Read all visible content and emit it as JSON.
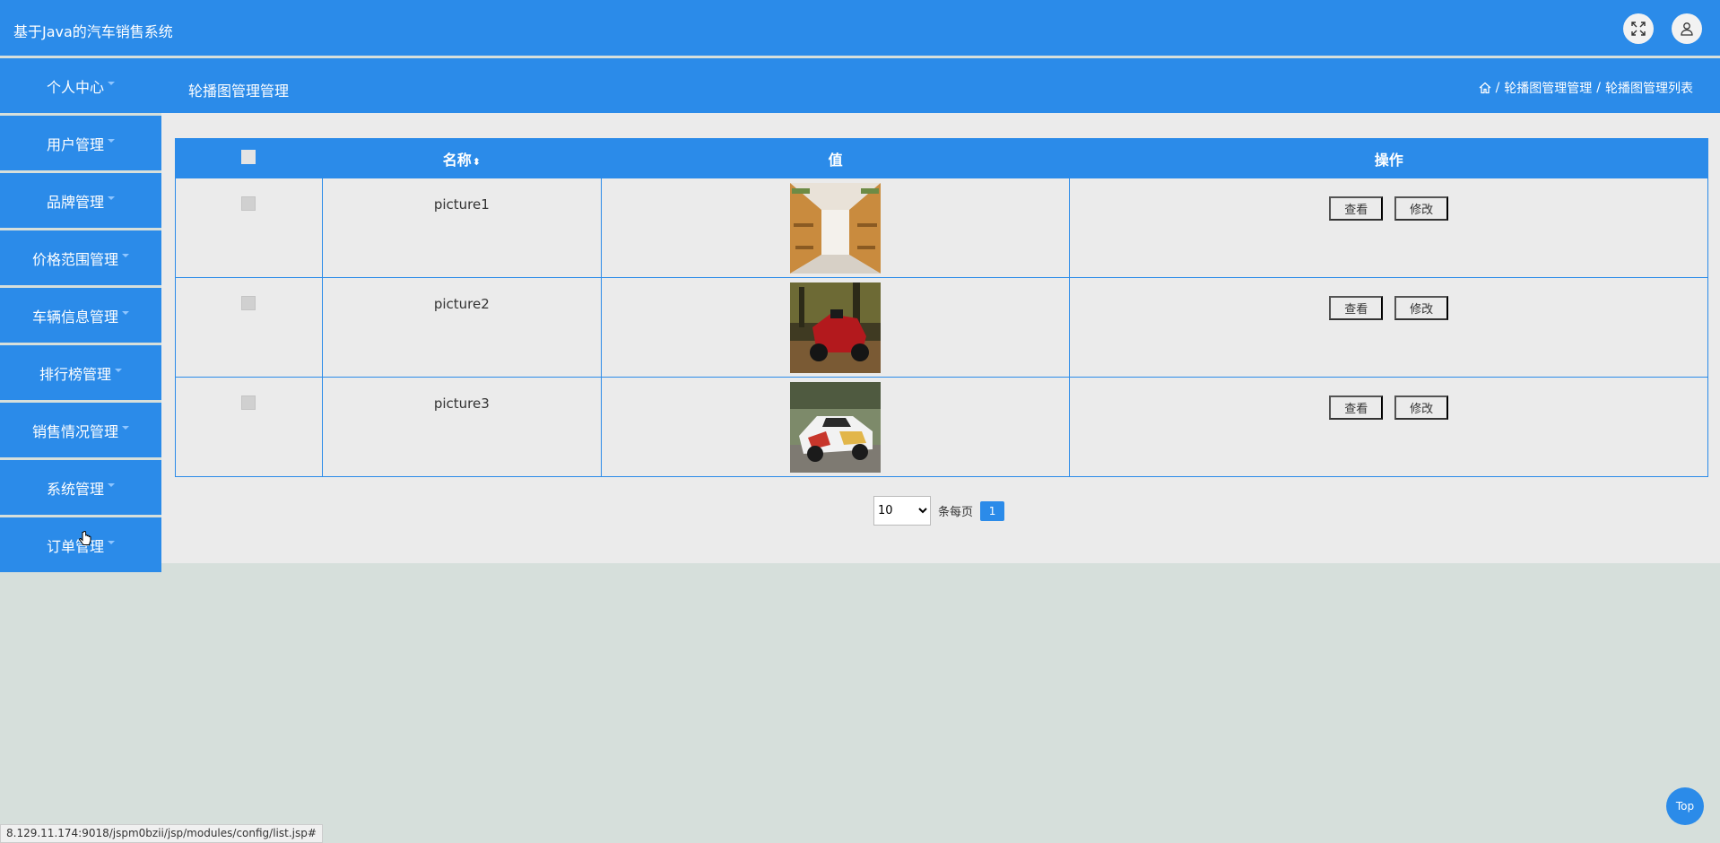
{
  "app": {
    "title": "基于Java的汽车销售系统"
  },
  "topbar": {
    "fullscreen_icon": "fullscreen-icon",
    "user_icon": "user-icon"
  },
  "subbar": {
    "page_title": "轮播图管理管理",
    "breadcrumb": [
      "轮播图管理管理",
      "轮播图管理列表"
    ],
    "home_icon": "home-icon",
    "separator": "/"
  },
  "sidebar": {
    "items": [
      {
        "label": "个人中心"
      },
      {
        "label": "用户管理"
      },
      {
        "label": "品牌管理"
      },
      {
        "label": "价格范围管理"
      },
      {
        "label": "车辆信息管理"
      },
      {
        "label": "排行榜管理"
      },
      {
        "label": "销售情况管理"
      },
      {
        "label": "系统管理"
      },
      {
        "label": "订单管理"
      }
    ]
  },
  "table": {
    "headers": {
      "name": "名称",
      "value": "值",
      "actions": "操作"
    },
    "rows": [
      {
        "name": "picture1",
        "image": "library-corridor-photo",
        "view": "查看",
        "edit": "修改"
      },
      {
        "name": "picture2",
        "image": "red-buggy-photo",
        "view": "查看",
        "edit": "修改"
      },
      {
        "name": "picture3",
        "image": "race-car-photo",
        "view": "查看",
        "edit": "修改"
      }
    ]
  },
  "pagination": {
    "page_size": "10",
    "page_size_options": [
      "10"
    ],
    "per_page_label": "条每页",
    "current_page": "1"
  },
  "status_bar": {
    "url": "8.129.11.174:9018/jspm0bzii/jsp/modules/config/list.jsp#"
  },
  "back_to_top": {
    "label": "Top"
  },
  "colors": {
    "primary": "#2b8be9",
    "content_bg": "#ebebeb",
    "page_bg": "#d6dfdb"
  }
}
